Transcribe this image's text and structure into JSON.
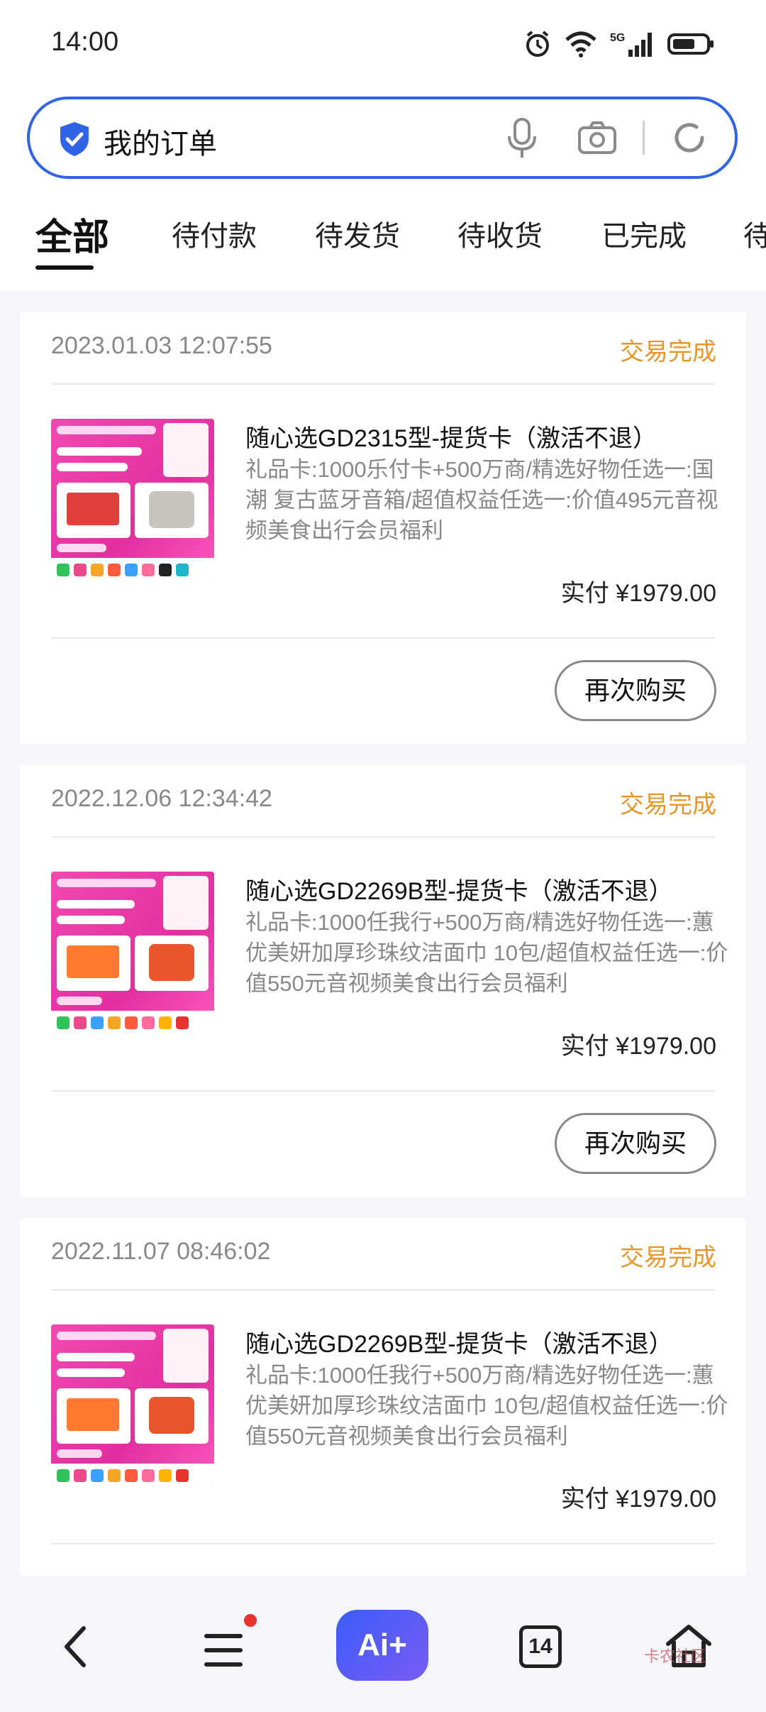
{
  "status_bar": {
    "time": "14:00"
  },
  "search": {
    "text": "我的订单"
  },
  "tabs": [
    {
      "label": "全部",
      "active": true
    },
    {
      "label": "待付款"
    },
    {
      "label": "待发货"
    },
    {
      "label": "待收货"
    },
    {
      "label": "已完成"
    },
    {
      "label": "待"
    }
  ],
  "orders": [
    {
      "date": "2023.01.03 12:07:55",
      "status": "交易完成",
      "title": "随心选GD2315型-提货卡（激活不退）",
      "desc": "礼品卡:1000乐付卡+500万商/精选好物任选一:国潮 复古蓝牙音箱/超值权益任选一:价值495元音视频美食出行会员福利",
      "paid": "实付 ¥1979.00",
      "button": "再次购买"
    },
    {
      "date": "2022.12.06 12:34:42",
      "status": "交易完成",
      "title": "随心选GD2269B型-提货卡（激活不退）",
      "desc": "礼品卡:1000任我行+500万商/精选好物任选一:蕙优美妍加厚珍珠纹洁面巾 10包/超值权益任选一:价值550元音视频美食出行会员福利",
      "paid": "实付 ¥1979.00",
      "button": "再次购买"
    },
    {
      "date": "2022.11.07 08:46:02",
      "status": "交易完成",
      "title": "随心选GD2269B型-提货卡（激活不退）",
      "desc": "礼品卡:1000任我行+500万商/精选好物任选一:蕙优美妍加厚珍珠纹洁面巾 10包/超值权益任选一:价值550元音视频美食出行会员福利",
      "paid": "实付 ¥1979.00"
    }
  ],
  "bottom_nav": {
    "ai_label": "Ai+",
    "tabs_count": "14",
    "watermark": "卡农社区"
  },
  "colors": {
    "accent": "#2f63e8",
    "status_orange": "#e8952c",
    "notification_red": "#e8322e"
  }
}
